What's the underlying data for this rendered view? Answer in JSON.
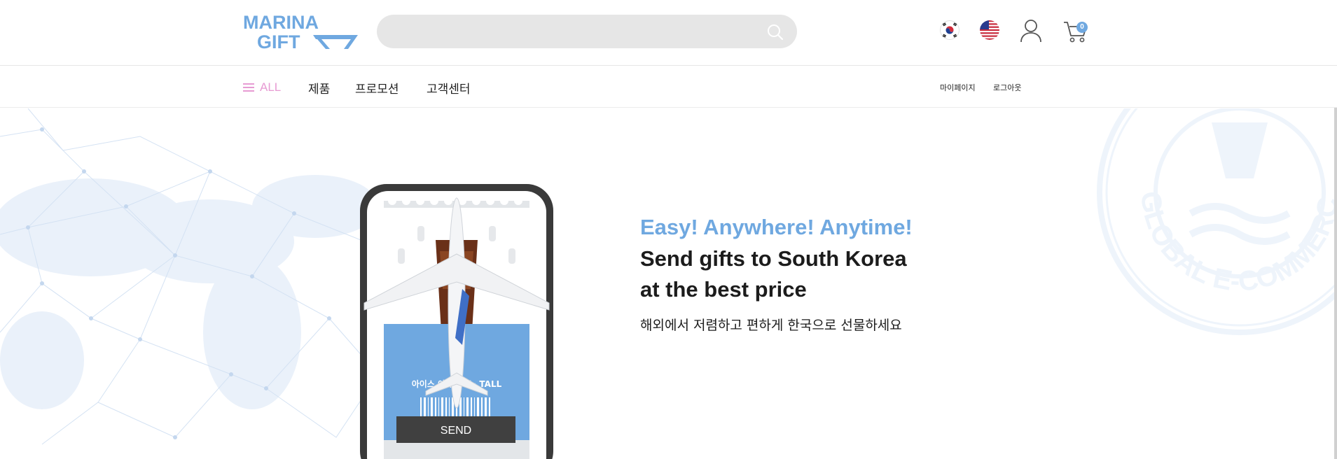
{
  "header": {
    "logo_line1": "MARINA",
    "logo_line2": "GIFT",
    "search_placeholder": "",
    "cart_count": "0",
    "brand_color": "#6fa8e0"
  },
  "nav": {
    "all_label": "ALL",
    "items": [
      "제품",
      "프로모션",
      "고객센터"
    ],
    "util": [
      "마이페이지",
      "로그아웃"
    ]
  },
  "hero": {
    "tagline": "Easy! Anywhere! Anytime!",
    "headline_line1": "Send gifts to South Korea",
    "headline_line2": "at the best price",
    "subtext": "해외에서 저렴하고 편하게 한국으로 선물하세요",
    "coupon_label": "아이스 아메리카노 TALL",
    "send_button": "SEND",
    "seal_text": "GLOBAL E-COMMERCE"
  },
  "icons": [
    "search-icon",
    "korea-flag-icon",
    "usa-flag-icon",
    "user-icon",
    "cart-icon",
    "menu-icon",
    "airplane-icon"
  ]
}
